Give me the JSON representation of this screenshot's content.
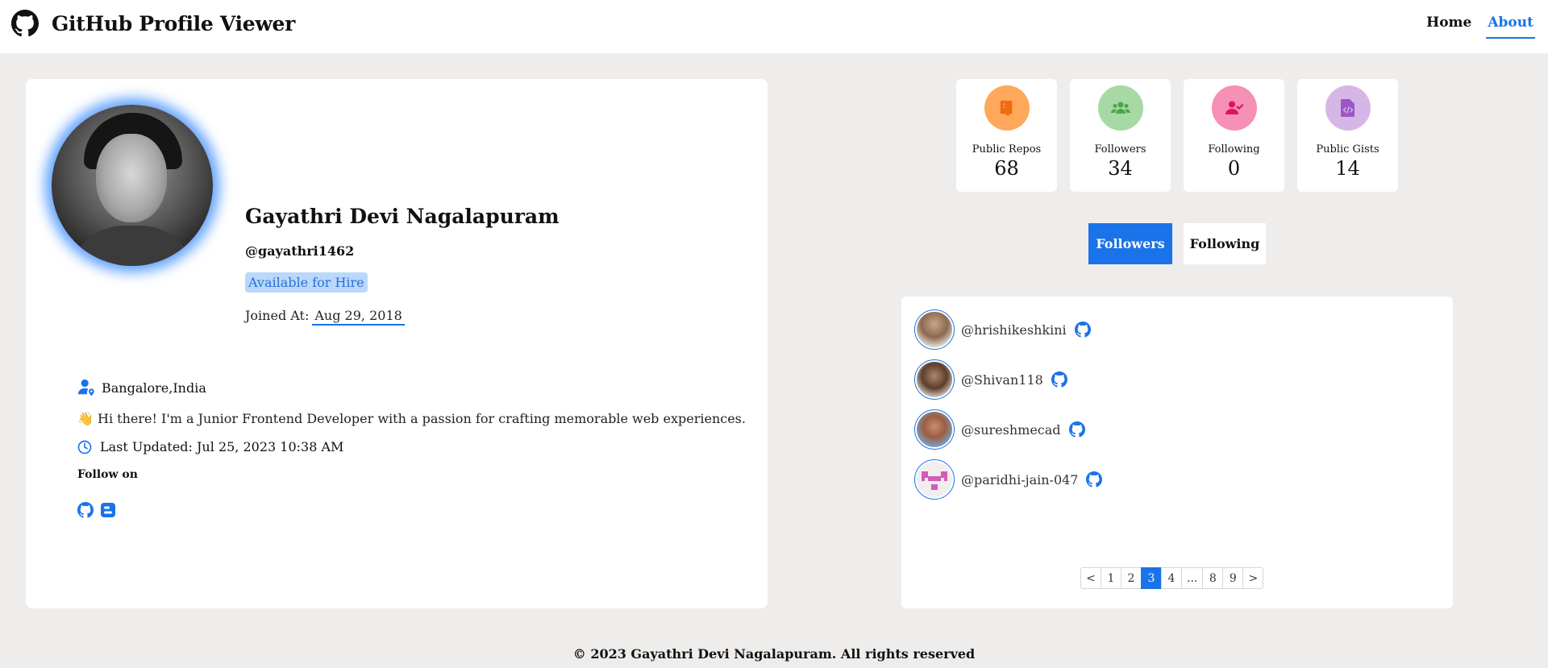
{
  "header": {
    "title": "GitHub Profile Viewer",
    "nav": [
      {
        "label": "Home",
        "active": false
      },
      {
        "label": "About",
        "active": true
      }
    ]
  },
  "profile": {
    "name": "Gayathri Devi Nagalapuram",
    "handle": "@gayathri1462",
    "hire_badge": "Available for Hire",
    "joined_label": "Joined At:",
    "joined_date": "Aug 29, 2018",
    "location": "Bangalore,India",
    "bio": "👋 Hi there! I'm a Junior Frontend Developer with a passion for crafting memorable web experiences.",
    "last_updated": "Last Updated: Jul 25, 2023 10:38 AM",
    "follow_on": "Follow on",
    "social_icons": [
      "github-icon",
      "blogger-icon"
    ]
  },
  "stats": [
    {
      "label": "Public Repos",
      "value": "68",
      "icon": "repo-book-icon",
      "color": "#ffa85c",
      "icon_color": "#f26b12"
    },
    {
      "label": "Followers",
      "value": "34",
      "icon": "users-group-icon",
      "color": "#a6d9a3",
      "icon_color": "#4aa64d"
    },
    {
      "label": "Following",
      "value": "0",
      "icon": "user-check-icon",
      "color": "#f690b4",
      "icon_color": "#e0115f"
    },
    {
      "label": "Public Gists",
      "value": "14",
      "icon": "code-file-icon",
      "color": "#d6b6e6",
      "icon_color": "#9b57c6"
    }
  ],
  "tabs": {
    "followers": "Followers",
    "following": "Following"
  },
  "followers": [
    {
      "username": "@hrishikeshkini"
    },
    {
      "username": "@Shivan118"
    },
    {
      "username": "@sureshmecad"
    },
    {
      "username": "@paridhi-jain-047"
    }
  ],
  "pagination": {
    "prev": "<",
    "next": ">",
    "pages": [
      "1",
      "2",
      "3",
      "4",
      "...",
      "8",
      "9"
    ],
    "current": "3"
  },
  "footer": "© 2023 Gayathri Devi Nagalapuram. All rights reserved",
  "colors": {
    "accent": "#1a73e8",
    "background": "#efedeb"
  }
}
